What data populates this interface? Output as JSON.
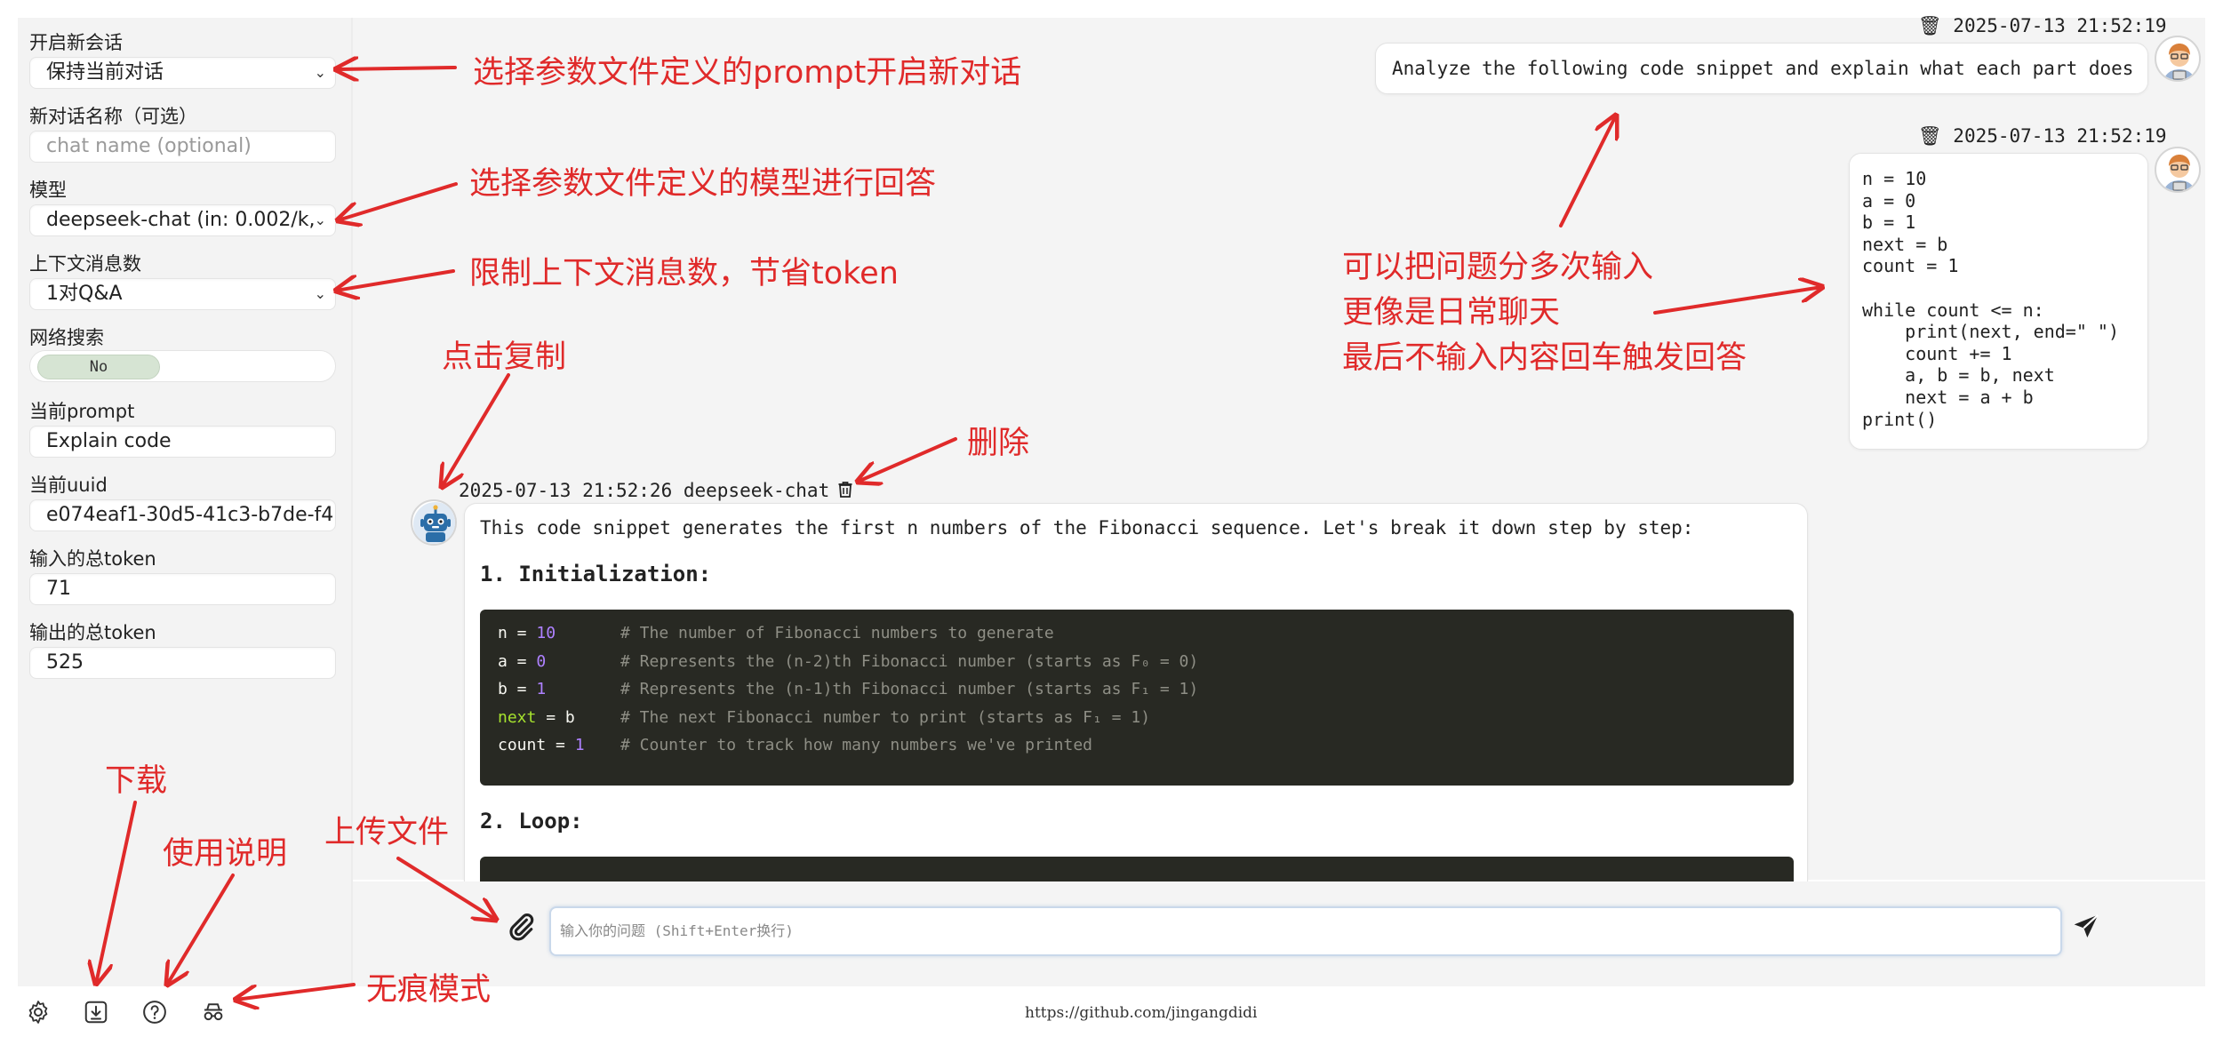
{
  "sidebar": {
    "new_chat": {
      "label": "开启新会话",
      "value": "保持当前对话"
    },
    "chat_name": {
      "label": "新对话名称（可选）",
      "placeholder": "chat name (optional)"
    },
    "model": {
      "label": "模型",
      "value": "deepseek-chat (in: 0.002/k,"
    },
    "context": {
      "label": "上下文消息数",
      "value": "1对Q&A"
    },
    "web_search": {
      "label": "网络搜索",
      "value": "No"
    },
    "prompt": {
      "label": "当前prompt",
      "value": "Explain code"
    },
    "uuid": {
      "label": "当前uuid",
      "value": "e074eaf1-30d5-41c3-b7de-f4"
    },
    "input_tokens": {
      "label": "输入的总token",
      "value": "71"
    },
    "output_tokens": {
      "label": "输出的总token",
      "value": "525"
    },
    "icons": [
      "gear-icon",
      "download-icon",
      "help-icon",
      "incognito-icon"
    ]
  },
  "chat": {
    "user_msg_1": {
      "timestamp": "🗑 2025-07-13 21:52:19",
      "text": "Analyze the following code snippet and explain what each part does"
    },
    "user_msg_2": {
      "timestamp": "🗑 2025-07-13 21:52:19",
      "code_lines": [
        "n = 10",
        "a = 0",
        "b = 1",
        "next = b",
        "count = 1",
        "",
        "while count <= n:",
        "    print(next, end=\" \")",
        "    count += 1",
        "    a, b = b, next",
        "    next = a + b",
        "print()"
      ]
    },
    "bot_msg": {
      "header": "2025-07-13 21:52:26 deepseek-chat",
      "intro": "This code snippet generates the first n numbers of the Fibonacci sequence. Let's break it down step by step:",
      "section1": "1. Initialization:",
      "code_block": [
        {
          "var": "n",
          "op": " = ",
          "val": "10",
          "comment": "# The number of Fibonacci numbers to generate"
        },
        {
          "var": "a",
          "op": " = ",
          "val": "0",
          "comment": "# Represents the (n-2)th Fibonacci number (starts as F₀ = 0)"
        },
        {
          "var": "b",
          "op": " = ",
          "val": "1",
          "comment": "# Represents the (n-1)th Fibonacci number (starts as F₁ = 1)"
        },
        {
          "var": "next",
          "op": " = ",
          "val": "b",
          "comment": "# The next Fibonacci number to print (starts as F₁ = 1)"
        },
        {
          "var": "count",
          "op": " = ",
          "val": "1",
          "comment": "# Counter to track how many numbers we've printed"
        }
      ],
      "section2": "2. Loop:"
    }
  },
  "input": {
    "placeholder": "输入你的问题 (Shift+Enter换行)"
  },
  "footer": {
    "link": "https://github.com/jingangdidi"
  },
  "annotations": {
    "new_chat": "选择参数文件定义的prompt开启新对话",
    "model": "选择参数文件定义的模型进行回答",
    "context": "限制上下文消息数，节省token",
    "copy": "点击复制",
    "delete": "删除",
    "multi_line1": "可以把问题分多次输入",
    "multi_line2": "更像是日常聊天",
    "multi_line3": "最后不输入内容回车触发回答",
    "download": "下载",
    "help": "使用说明",
    "upload": "上传文件",
    "incognito": "无痕模式"
  },
  "colors": {
    "annotation": "#e02a2a",
    "code_bg": "#282923",
    "accent_number": "#ae81ff",
    "accent_keyword": "#a6e22e"
  }
}
